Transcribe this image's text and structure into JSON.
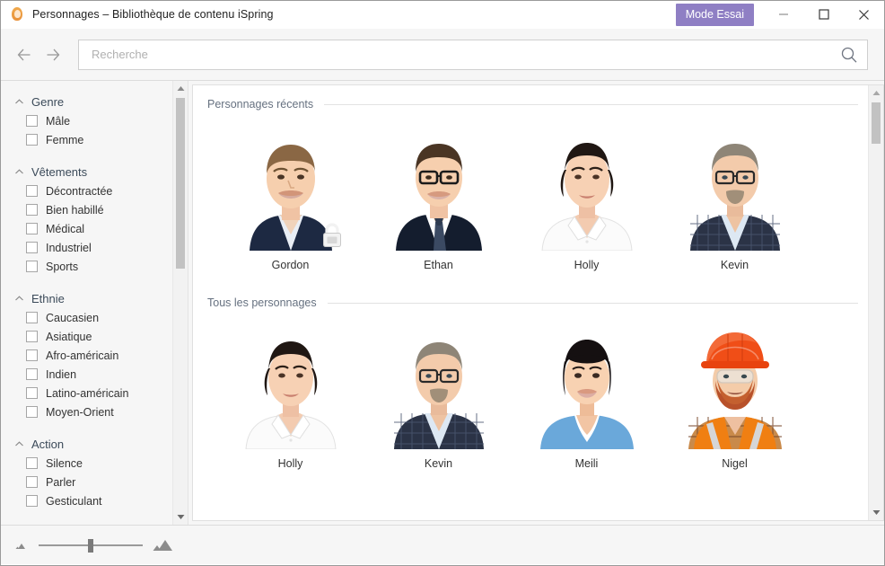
{
  "window": {
    "title": "Personnages – Bibliothèque de contenu iSpring",
    "app_icon": "character-avatar-icon",
    "trial_badge": "Mode Essai",
    "trial_badge_color": "#8f7fc4",
    "controls": {
      "minimize": "minimize-icon",
      "maximize": "maximize-icon",
      "close": "close-icon"
    }
  },
  "toolbar": {
    "back": "back-arrow-icon",
    "forward": "forward-arrow-icon",
    "search_placeholder": "Recherche",
    "search_value": "",
    "search_icon": "search-icon"
  },
  "sidebar": {
    "groups": [
      {
        "title": "Genre",
        "expanded": true,
        "options": [
          {
            "label": "Mâle",
            "checked": false
          },
          {
            "label": "Femme",
            "checked": false
          }
        ]
      },
      {
        "title": "Vêtements",
        "expanded": true,
        "options": [
          {
            "label": "Décontractée",
            "checked": false
          },
          {
            "label": "Bien habillé",
            "checked": false
          },
          {
            "label": "Médical",
            "checked": false
          },
          {
            "label": "Industriel",
            "checked": false
          },
          {
            "label": "Sports",
            "checked": false
          }
        ]
      },
      {
        "title": "Ethnie",
        "expanded": true,
        "options": [
          {
            "label": "Caucasien",
            "checked": false
          },
          {
            "label": "Asiatique",
            "checked": false
          },
          {
            "label": "Afro-américain",
            "checked": false
          },
          {
            "label": "Indien",
            "checked": false
          },
          {
            "label": "Latino-américain",
            "checked": false
          },
          {
            "label": "Moyen-Orient",
            "checked": false
          }
        ]
      },
      {
        "title": "Action",
        "expanded": true,
        "options": [
          {
            "label": "Silence",
            "checked": false
          },
          {
            "label": "Parler",
            "checked": false
          },
          {
            "label": "Gesticulant",
            "checked": false
          }
        ]
      }
    ]
  },
  "content": {
    "sections": [
      {
        "title": "Personnages récents",
        "items": [
          {
            "name": "Gordon",
            "locked": true,
            "portrait": "man-navy-suit-striped-shirt"
          },
          {
            "name": "Ethan",
            "locked": false,
            "portrait": "man-glasses-dark-suit-tie"
          },
          {
            "name": "Holly",
            "locked": false,
            "portrait": "woman-dark-hair-white-blouse"
          },
          {
            "name": "Kevin",
            "locked": false,
            "portrait": "man-glasses-beard-check-blazer"
          }
        ]
      },
      {
        "title": "Tous les personnages",
        "items": [
          {
            "name": "Holly",
            "locked": false,
            "portrait": "woman-dark-hair-white-blouse"
          },
          {
            "name": "Kevin",
            "locked": false,
            "portrait": "man-glasses-beard-check-blazer"
          },
          {
            "name": "Meili",
            "locked": false,
            "portrait": "woman-asian-bob-blue-scrubs"
          },
          {
            "name": "Nigel",
            "locked": false,
            "portrait": "man-orange-hardhat-hivis-vest"
          }
        ]
      }
    ]
  },
  "bottombar": {
    "zoom_small_icon": "small-thumbnail-icon",
    "zoom_large_icon": "large-thumbnail-icon",
    "zoom_value": 50
  },
  "scrollbars": {
    "sidebar": {
      "up": "scroll-up-arrow",
      "down": "scroll-down-arrow"
    },
    "content": {
      "up": "scroll-up-arrow",
      "down": "scroll-down-arrow"
    }
  }
}
